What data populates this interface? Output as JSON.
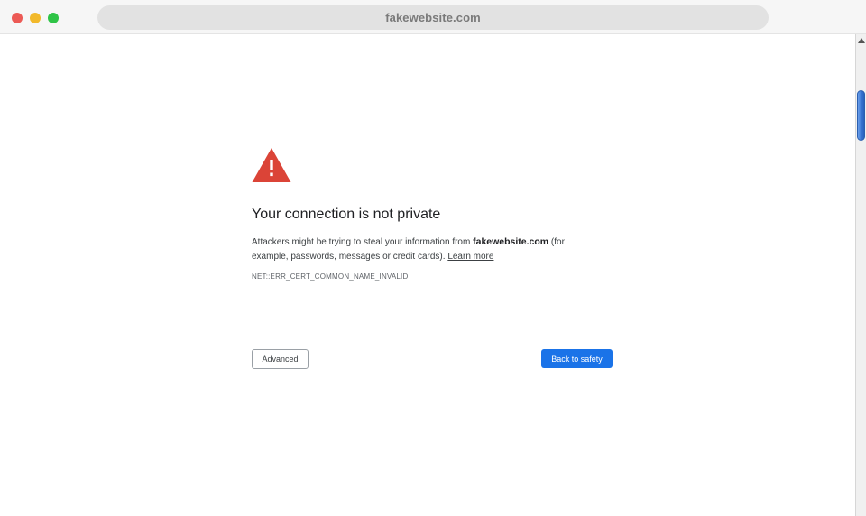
{
  "browser": {
    "address": "fakewebsite.com"
  },
  "interstitial": {
    "title": "Your connection is not private",
    "description_before": "Attackers might be trying to steal your information from ",
    "site_name": "fakewebsite.com",
    "description_after": " (for example, passwords, messages or credit cards). ",
    "learn_more": "Learn more",
    "error_code": "NET::ERR_CERT_COMMON_NAME_INVALID",
    "advanced_label": "Advanced",
    "back_label": "Back to safety",
    "icon": "warning-triangle-icon"
  },
  "colors": {
    "warning_red": "#db4437",
    "primary_blue": "#1a73e8"
  }
}
